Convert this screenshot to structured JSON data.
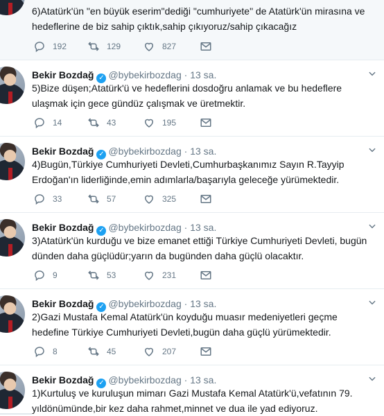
{
  "tweets": [
    {
      "name": "",
      "handle": "",
      "time": "",
      "text": "6)Atatürk'ün \"en büyük eserim\"dediği \"cumhuriyete\" de Atatürk'ün mirasına ve hedeflerine de biz sahip çıktık,sahip çıkıyoruz/sahip çıkacağız",
      "replies": "192",
      "retweets": "129",
      "likes": "827"
    },
    {
      "name": "Bekir Bozdağ",
      "handle": "@bybekirbozdag",
      "time": "· 13 sa.",
      "text": "5)Bize düşen;Atatürk'ü ve hedeflerini dosdoğru anlamak ve bu hedeflere ulaşmak için gece gündüz çalışmak ve üretmektir.",
      "replies": "14",
      "retweets": "43",
      "likes": "195"
    },
    {
      "name": "Bekir Bozdağ",
      "handle": "@bybekirbozdag",
      "time": "· 13 sa.",
      "text": "4)Bugün,Türkiye Cumhuriyeti Devleti,Cumhurbaşkanımız Sayın R.Tayyip Erdoğan'ın liderliğinde,emin adımlarla/başarıyla geleceğe yürümektedir.",
      "replies": "33",
      "retweets": "57",
      "likes": "325"
    },
    {
      "name": "Bekir Bozdağ",
      "handle": "@bybekirbozdag",
      "time": "· 13 sa.",
      "text": "3)Atatürk'ün kurduğu ve bize emanet ettiği Türkiye Cumhuriyeti Devleti, bugün dünden daha güçlüdür;yarın da bugünden daha güçlü olacaktır.",
      "replies": "9",
      "retweets": "53",
      "likes": "231"
    },
    {
      "name": "Bekir Bozdağ",
      "handle": "@bybekirbozdag",
      "time": "· 13 sa.",
      "text": "2)Gazi Mustafa Kemal Atatürk'ün koyduğu muasır medeniyetleri geçme hedefine Türkiye Cumhuriyeti Devleti,bugün daha güçlü yürümektedir.",
      "replies": "8",
      "retweets": "45",
      "likes": "207"
    },
    {
      "name": "Bekir Bozdağ",
      "handle": "@bybekirbozdag",
      "time": "· 13 sa.",
      "text": "1)Kurtuluş ve kuruluşun mimarı Gazi Mustafa Kemal Atatürk'ü,vefatının 79. yıldönümünde,bir kez daha rahmet,minnet ve dua ile yad ediyoruz.",
      "replies": "",
      "retweets": "",
      "likes": ""
    }
  ],
  "icons": {
    "reply": "reply-icon",
    "retweet": "retweet-icon",
    "like": "like-icon",
    "dm": "message-icon",
    "verified": "verified-badge-icon",
    "more": "chevron-down-icon"
  },
  "colors": {
    "verified": "#1da1f2",
    "muted": "#657786",
    "text": "#14171a"
  }
}
